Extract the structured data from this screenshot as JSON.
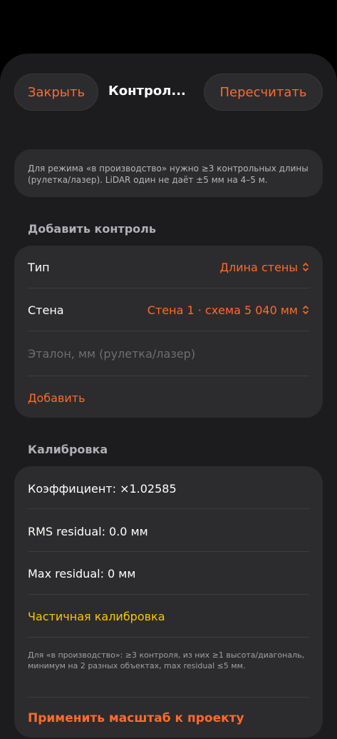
{
  "header": {
    "close_label": "Закрыть",
    "title": "Контрол...",
    "recalc_label": "Пересчитать"
  },
  "note": "Для режима «в производство» нужно ≥3 контрольных длины (рулетка/лазер). LiDAR один не даёт ±5 мм на 4–5 м.",
  "add_section": {
    "title": "Добавить контроль",
    "type_label": "Тип",
    "type_value": "Длина стены",
    "wall_label": "Стена",
    "wall_value": "Стена 1 · схема 5 040 мм",
    "reference_placeholder": "Эталон, мм (рулетка/лазер)",
    "add_label": "Добавить"
  },
  "calibration": {
    "title": "Калибровка",
    "coefficient": "Коэффициент: ×1.02585",
    "rms": "RMS residual: 0.0 мм",
    "max": "Max residual: 0 мм",
    "status": "Частичная калибровка",
    "hint": "Для «в производство»: ≥3 контроля, из них ≥1 высота/диагональ, минимум на 2 разных объектах, max residual ≤5 мм.",
    "apply_label": "Применить масштаб к проекту"
  },
  "colors": {
    "accent": "#ff6a2c",
    "warning": "#ffc400",
    "background": "#1c1c1e",
    "card": "#2c2c2e"
  }
}
